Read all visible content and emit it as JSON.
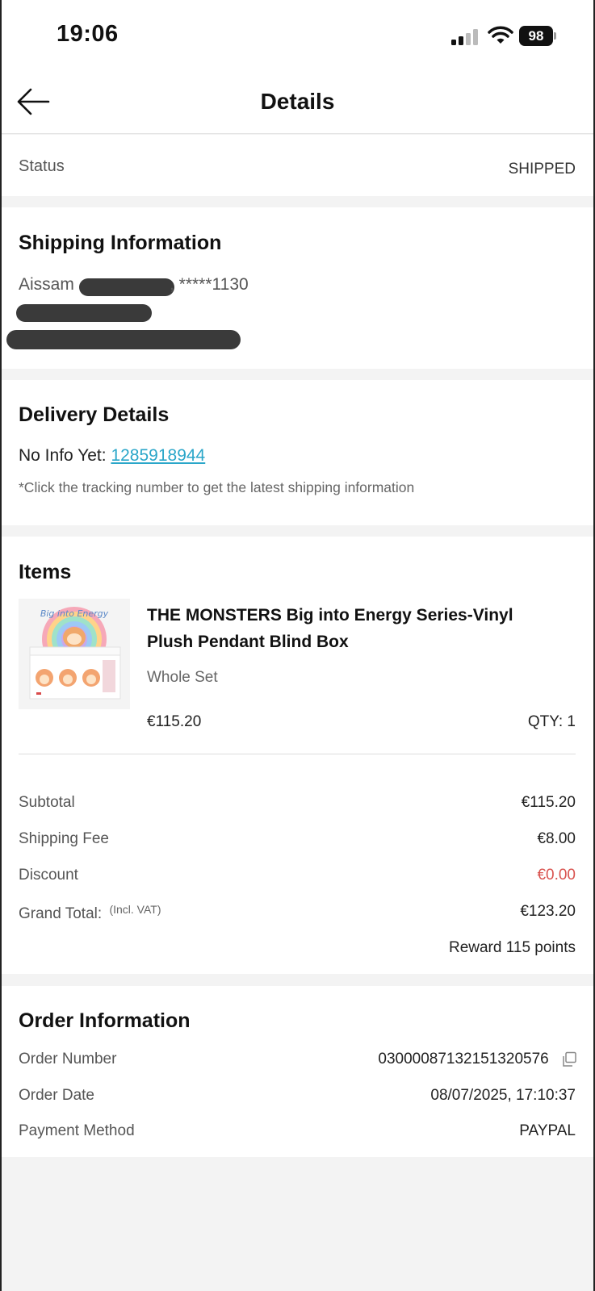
{
  "status_bar": {
    "time": "19:06",
    "battery": "98"
  },
  "header": {
    "title": "Details"
  },
  "status": {
    "label": "Status",
    "value": "SHIPPED"
  },
  "shipping": {
    "heading": "Shipping Information",
    "name_visible": "Aissam",
    "phone": ", *****1130"
  },
  "delivery": {
    "heading": "Delivery Details",
    "no_info": "No Info Yet: ",
    "tracking_number": "1285918944",
    "note": "*Click the tracking number to get the latest shipping information"
  },
  "items": {
    "heading": "Items",
    "product": {
      "title_line1": "THE MONSTERS Big into Energy Series-Vinyl",
      "title_line2": "Plush Pendant Blind Box",
      "variant": "Whole Set",
      "price": "€115.20",
      "qty": "QTY: 1"
    },
    "summary": {
      "subtotal_label": "Subtotal",
      "subtotal_value": "€115.20",
      "shipping_label": "Shipping Fee",
      "shipping_value": "€8.00",
      "discount_label": "Discount",
      "discount_value": "€0.00",
      "grand_label": "Grand Total:",
      "grand_note": "(Incl. VAT)",
      "grand_value": "€123.20",
      "reward": "Reward 115 points"
    }
  },
  "order": {
    "heading": "Order Information",
    "number_label": "Order Number",
    "number_value": "03000087132151320576",
    "date_label": "Order Date",
    "date_value": "08/07/2025, 17:10:37",
    "payment_label": "Payment Method",
    "payment_value": "PAYPAL"
  },
  "colors": {
    "link": "#2aa6c9",
    "discount": "#d9534f",
    "page_bg": "#f3f3f3"
  }
}
